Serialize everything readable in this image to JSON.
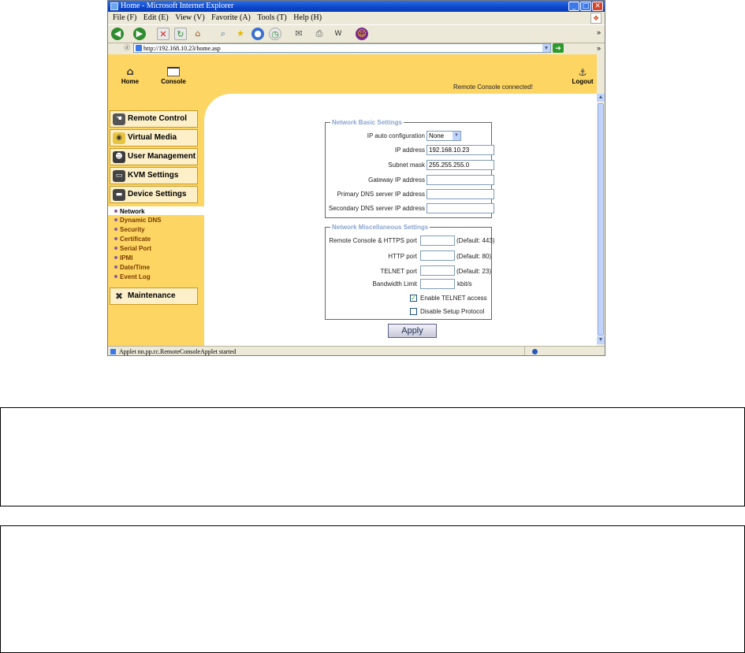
{
  "window": {
    "title": "Home - Microsoft Internet Explorer"
  },
  "menubar": [
    "File (F)",
    "Edit (E)",
    "View (V)",
    "Favorite (A)",
    "Tools (T)",
    "Help (H)"
  ],
  "address": {
    "url": "http://192.168.10.23/home.asp"
  },
  "header": {
    "home_label": "Home",
    "console_label": "Console",
    "status_text": "Remote Console connected!",
    "logout_label": "Logout"
  },
  "sidebar": {
    "sections": [
      {
        "label": "Remote Control",
        "icon": "hand-icon"
      },
      {
        "label": "Virtual Media",
        "icon": "cd-icon"
      },
      {
        "label": "User Management",
        "icon": "users-icon"
      },
      {
        "label": "KVM Settings",
        "icon": "monitor-icon"
      },
      {
        "label": "Device Settings",
        "icon": "device-icon"
      }
    ],
    "subitems": [
      "Network",
      "Dynamic DNS",
      "Security",
      "Certificate",
      "Serial Port",
      "IPMI",
      "Date/Time",
      "Event Log"
    ],
    "maintenance_label": "Maintenance"
  },
  "basic": {
    "legend": "Network Basic Settings",
    "ip_auto_label": "IP auto configuration",
    "ip_auto_value": "None",
    "ip_label": "IP address",
    "ip_value": "192.168.10.23",
    "mask_label": "Subnet mask",
    "mask_value": "255.255.255.0",
    "gateway_label": "Gateway IP address",
    "gateway_value": "",
    "dns1_label": "Primary DNS server IP address",
    "dns1_value": "",
    "dns2_label": "Secondary DNS server IP address",
    "dns2_value": ""
  },
  "misc": {
    "legend": "Network Miscellaneous Settings",
    "https_label": "Remote Console & HTTPS port",
    "https_value": "",
    "https_default": "(Default: 443)",
    "http_label": "HTTP port",
    "http_value": "",
    "http_default": "(Default: 80)",
    "telnet_label": "TELNET port",
    "telnet_value": "",
    "telnet_default": "(Default: 23)",
    "bw_label": "Bandwidth Limit",
    "bw_value": "",
    "bw_unit": "kbit/s",
    "enable_telnet_label": "Enable TELNET access",
    "enable_telnet_checked": true,
    "disable_setup_label": "Disable Setup Protocol",
    "disable_setup_checked": false
  },
  "apply_label": "Apply",
  "statusbar": {
    "text": "Applet nn.pp.rc.RemoteConsoleApplet started"
  },
  "colors": {
    "page_bg": "#fdd563",
    "panel_bg": "#ffffff",
    "legend_text": "#8aa4d0",
    "sub_link": "#7a3c00"
  }
}
